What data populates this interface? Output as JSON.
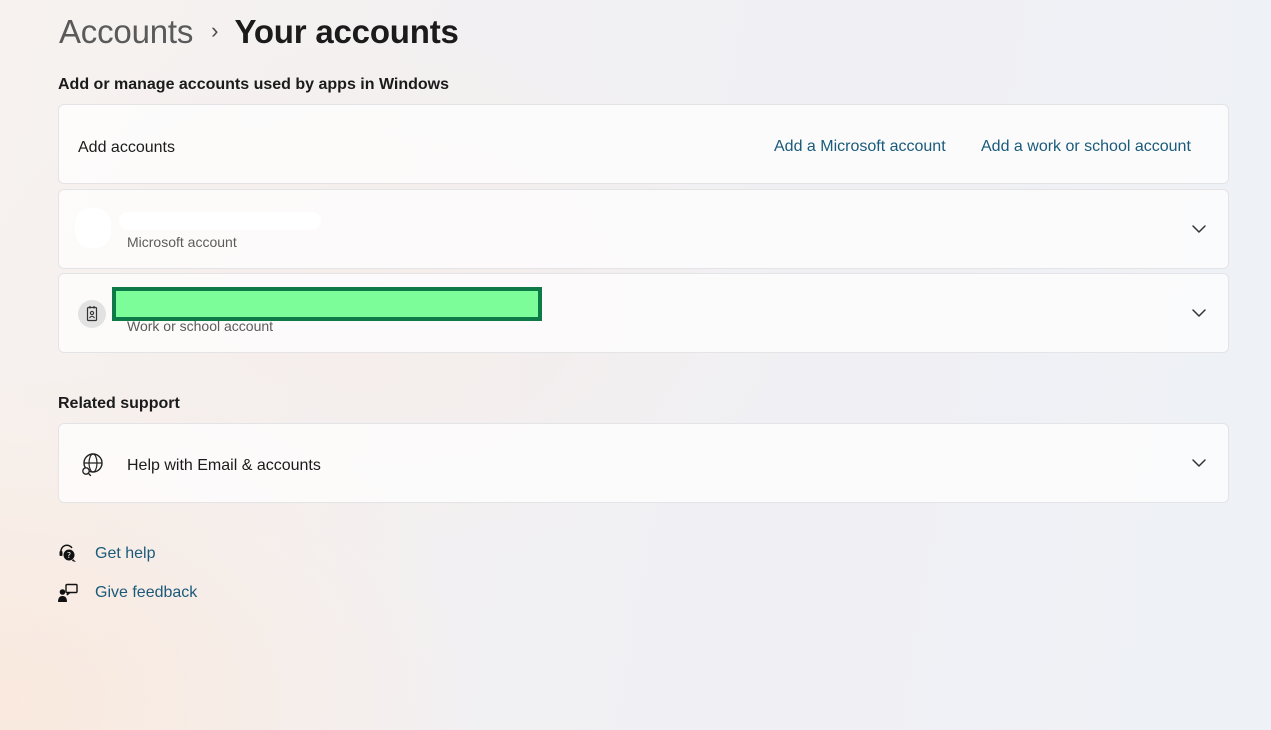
{
  "breadcrumb": {
    "parent": "Accounts",
    "separator": "›",
    "current": "Your accounts"
  },
  "section_manage": {
    "heading": "Add or manage accounts used by apps in Windows"
  },
  "add_accounts": {
    "label": "Add accounts",
    "microsoft_link": "Add a Microsoft account",
    "work_link": "Add a work or school account"
  },
  "accounts": [
    {
      "type_label": "Microsoft account",
      "icon": "avatar-icon"
    },
    {
      "type_label": "Work or school account",
      "icon": "badge-icon"
    }
  ],
  "related_support": {
    "heading": "Related support",
    "help_item": "Help with Email & accounts",
    "help_icon": "globe-icon"
  },
  "footer": {
    "get_help": "Get help",
    "give_feedback": "Give feedback"
  },
  "colors": {
    "link": "#1a5a7a",
    "redaction_fill": "#7dfc9a",
    "redaction_border": "#0d7a47"
  }
}
